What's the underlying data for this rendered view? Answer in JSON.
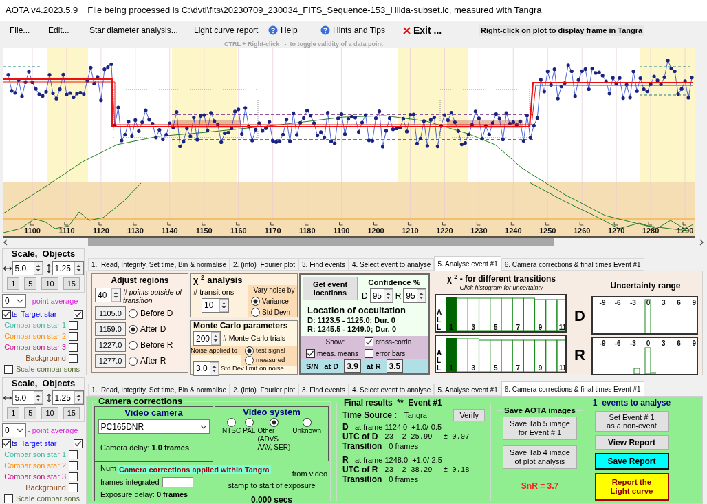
{
  "window": {
    "app": "AOTA v4.2023.5.9",
    "title": "File being processed is C:\\dvti\\fits\\20230709_230034_FITS_Sequence-153_Hilda-subset.lc, measured with Tangra"
  },
  "menu": [
    {
      "label": "File...",
      "kind": "text"
    },
    {
      "label": "Edit...",
      "kind": "text"
    },
    {
      "label": "Star diameter analysis...",
      "kind": "text"
    },
    {
      "label": "Light curve report",
      "kind": "text"
    },
    {
      "label": "Help",
      "kind": "help"
    },
    {
      "label": "Hints and Tips",
      "kind": "help"
    },
    {
      "label": "Exit ...",
      "kind": "exit"
    }
  ],
  "plot_hint": "Right-click on plot to display frame in Tangra",
  "toggle_hint": "CTRL + Right-click   -  to toggle validity of a data point",
  "plot": {
    "x_labels": [
      "1100",
      "1110",
      "1120",
      "1130",
      "1140",
      "1150",
      "1160",
      "1170",
      "1180",
      "1190",
      "1200",
      "1210",
      "1220",
      "1230",
      "1240",
      "1250",
      "1260",
      "1270",
      "1280",
      "1290"
    ]
  },
  "top_section": {
    "side_panel": {
      "title": "Scale,  Objects",
      "h_scale": "5.0",
      "v_scale": "1.25",
      "scale_buttons": [
        "1",
        "5",
        "10",
        "15"
      ],
      "point_average": "0",
      "point_average_label": "- point average",
      "plot_points": {
        "label": "ts",
        "checked": true
      },
      "objects": [
        {
          "label": "Target star",
          "color": "#0000ff",
          "checked": true
        },
        {
          "label": "Comparison star 1",
          "color": "#3cb8a0",
          "checked": false
        },
        {
          "label": "Comparison star 2",
          "color": "#ff8c00",
          "checked": false
        },
        {
          "label": "Comparison star 3",
          "color": "#c71585",
          "checked": false
        },
        {
          "label": "Background",
          "color": "#8b4513",
          "checked": false
        }
      ],
      "scale_comparisons": {
        "label": "Scale comparisons",
        "checked": false
      }
    },
    "tabs": [
      {
        "label": "1.  Read, Integrity, Set time, Bin & normalise",
        "selected": false
      },
      {
        "label": "2. (info)  Fourier plot",
        "selected": false
      },
      {
        "label": "3. Find events",
        "selected": false
      },
      {
        "label": "4. Select event to analyse",
        "selected": false
      },
      {
        "label": "5. Analyse event #1",
        "selected": true
      },
      {
        "label": "6. Camera corrections & final times Event #1",
        "selected": false
      }
    ],
    "analyse_tab": {
      "adjust_regions": {
        "title": "Adjust regions",
        "points": "40",
        "points_label": "# points outside of transition",
        "regions": [
          {
            "value": "1105.0",
            "label": "Before D",
            "selected": false
          },
          {
            "value": "1159.0",
            "label": "After D",
            "selected": true
          },
          {
            "value": "1227.0",
            "label": "Before R",
            "selected": false
          },
          {
            "value": "1277.0",
            "label": "After R",
            "selected": false
          }
        ]
      },
      "chi2": {
        "title": "χ $^{2}$ analysis",
        "transitions_label": "# transitions",
        "transitions": "10",
        "vary_noise_title": "Vary noise by",
        "vary_noise": [
          {
            "label": "Variance",
            "selected": true
          },
          {
            "label": "Std Devn",
            "selected": false
          }
        ]
      },
      "monte_carlo": {
        "title": "Monte Carlo parameters",
        "trials": "200",
        "trials_label": "# Monte Carlo trials",
        "noise_label": "Noise applied to",
        "noise_options": [
          {
            "label": "test signal",
            "selected": true
          },
          {
            "label": "measured",
            "selected": false
          }
        ],
        "std_limit": "3.0",
        "std_limit_label": "Std Dev limit on noise"
      },
      "event": {
        "button": "Get event locations",
        "confidence_title": "Confidence %",
        "d_label": "D",
        "d_confidence": "95",
        "r_label": "R",
        "r_confidence": "95",
        "location_title": "Location of occultation",
        "d_location": "D: 1123.5 - 1125.0; Dur. 0",
        "r_location": "R: 1245.5 - 1249.0; Dur. 0",
        "show_label": "Show:",
        "show_options": [
          {
            "label": "cross-corrln",
            "checked": true
          },
          {
            "label": "meas. means",
            "checked": true
          },
          {
            "label": "error bars",
            "checked": false
          }
        ],
        "sn_label": "S/N",
        "sn_d_label": "at D",
        "sn_d": "3.9",
        "sn_r_label": "at R",
        "sn_r": "3.5"
      },
      "histograms": {
        "title": "χ $^{2}$ -  for different transitions",
        "subtitle": "Click histogram for uncertainty",
        "charts": [
          {
            "letters": "ALL",
            "labels": [
              "1",
              "3",
              "5",
              "7",
              "9",
              "11"
            ]
          },
          {
            "letters": "ALL",
            "labels": [
              "1",
              "3",
              "5",
              "7",
              "9",
              "11"
            ]
          }
        ]
      },
      "uncertainty": {
        "title": "Uncertainty range",
        "charts": [
          {
            "label": "D",
            "ticks": [
              "-9",
              "-6",
              "-3",
              "0",
              "3",
              "6",
              "9"
            ]
          },
          {
            "label": "R",
            "ticks": [
              "-9",
              "-6",
              "-3",
              "0",
              "3",
              "6",
              "9"
            ]
          }
        ]
      }
    }
  },
  "bottom_section": {
    "side_panel": {
      "title": "Scale,  Objects",
      "h_scale": "5.0",
      "v_scale": "1.25",
      "scale_buttons": [
        "1",
        "5",
        "10",
        "15"
      ],
      "point_average": "0",
      "point_average_label": "- point average",
      "plot_points": {
        "label": "ts",
        "checked": true
      },
      "objects": [
        {
          "label": "Target star",
          "color": "#0000ff",
          "checked": true
        },
        {
          "label": "Comparison star 1",
          "color": "#3cb8a0",
          "checked": false
        },
        {
          "label": "Comparison star 2",
          "color": "#ff8c00",
          "checked": false
        },
        {
          "label": "Comparison star 3",
          "color": "#c71585",
          "checked": false
        },
        {
          "label": "Background",
          "color": "#8b4513",
          "checked": false
        }
      ],
      "scale_comparisons": {
        "label": "Scale comparisons",
        "checked": false
      }
    },
    "tabs": [
      {
        "label": "1.  Read, Integrity, Set time, Bin & normalise",
        "selected": false
      },
      {
        "label": "2. (info)  Fourier plot",
        "selected": false
      },
      {
        "label": "3. Find events",
        "selected": false
      },
      {
        "label": "4. Select event to analyse",
        "selected": false
      },
      {
        "label": "5. Analyse event #1",
        "selected": false
      },
      {
        "label": "6. Camera corrections & final times Event #1",
        "selected": true
      }
    ],
    "camera_tab": {
      "camera_corrections": {
        "title": "Camera corrections",
        "video_camera_title": "Video camera",
        "camera": "PC165DNR",
        "camera_delay_label": "Camera delay:",
        "camera_delay": "1.0 frames",
        "video_system_title": "Video system",
        "video_systems": [
          {
            "label": "NTSC",
            "selected": false
          },
          {
            "label": "PAL",
            "selected": false
          },
          {
            "label": "Other\n(ADVS\nAAV, SER)",
            "selected": true
          },
          {
            "label": "Unknown",
            "selected": false
          }
        ],
        "frames_label_start": "Num",
        "frames_label_end": "frames integrated",
        "exposure_delay_label": "Exposure delay:",
        "exposure_delay": "0 frames",
        "offset_label_1": "from video",
        "offset_label_2": "stamp to start of exposure",
        "offset": "0.000 secs",
        "banner": "Camera corrections applied within Tangra"
      },
      "final_results": {
        "title": "Final results  **  Event #1",
        "verify": "Verify",
        "time_source_label": "Time Source :",
        "time_source": "Tangra",
        "events": [
          {
            "letter": "D",
            "frame": "at frame 1124.0  +1.0/-0.5",
            "utc_label": "UTC of D",
            "utc": "23  2 25.99",
            "error": "± 0.07",
            "transition_label": "Transition",
            "transition": "0 frames"
          },
          {
            "letter": "R",
            "frame": "at frame 1248.0  +1.0/-2.5",
            "utc_label": "UTC of R",
            "utc": "23  2 38.29",
            "error": "± 0.18",
            "transition_label": "Transition",
            "transition": "0 frames"
          }
        ]
      },
      "save_images": {
        "title": "Save AOTA images",
        "buttons": [
          "Save Tab 5 image\nfor Event # 1",
          "Save Tab 4 image\nof plot analysis"
        ],
        "snr": "SnR = 3.7"
      },
      "actions": {
        "events_label": "1  events to analyse",
        "buttons": [
          {
            "label": "Set Event # 1\nas a non-event",
            "kind": "plain"
          },
          {
            "label": "View Report",
            "kind": "bold"
          },
          {
            "label": "Save Report",
            "kind": "cyan"
          },
          {
            "label": "Report the\nLight curve",
            "kind": "yellow"
          }
        ]
      }
    }
  }
}
